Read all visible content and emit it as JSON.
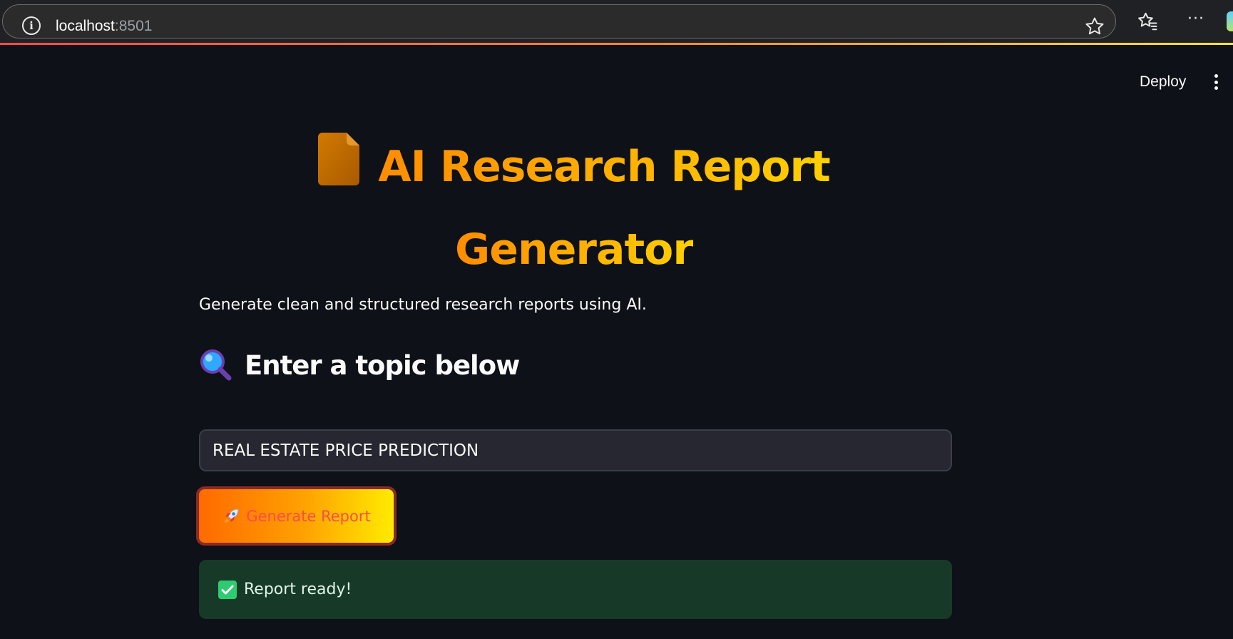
{
  "browser": {
    "url_host": "localhost",
    "url_port": ":8501",
    "icons": [
      "info-icon",
      "star-icon",
      "favorites-icon",
      "more-icon"
    ]
  },
  "header": {
    "deploy_label": "Deploy",
    "menu_icon": "vertical-dots-icon"
  },
  "main": {
    "title_line_1": "AI Research Report",
    "title_line_2": "Generator",
    "title_icon": "document-icon",
    "subtitle": "Generate clean and structured research reports using AI.",
    "section_heading": "Enter a topic below",
    "section_icon": "magnifier-icon",
    "topic_input": {
      "value": "REAL ESTATE PRICE PREDICTION"
    },
    "generate_button": {
      "label": "Generate Report",
      "icon": "rocket-icon"
    },
    "success": {
      "message": "Report ready!",
      "icon": "check-icon"
    }
  },
  "colors": {
    "background": "#0e1117",
    "title_gradient_start": "#ff8c00",
    "title_gradient_end": "#ffd000",
    "button_gradient_start": "#ff6a00",
    "button_gradient_end": "#ffeb00",
    "button_text": "#ff4b4b",
    "success_bg": "#173928"
  }
}
